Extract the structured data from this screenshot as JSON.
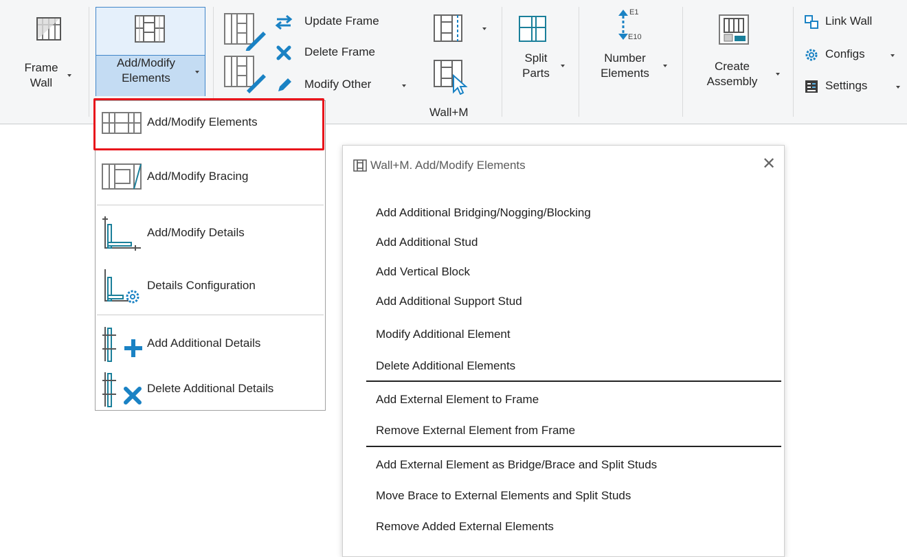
{
  "ribbon": {
    "frame_wall": {
      "line1": "Frame",
      "line2": "Wall"
    },
    "add_modify": {
      "line1": "Add/Modify",
      "line2": "Elements"
    },
    "update_frame": "Update Frame",
    "delete_frame": "Delete Frame",
    "modify_other": "Modify Other",
    "group_title": "Wall+M",
    "split_parts": {
      "line1": "Split",
      "line2": "Parts"
    },
    "number_elements": {
      "line1": "Number",
      "line2": "Elements",
      "tag_top": "E1",
      "tag_bottom": "E10"
    },
    "create_assembly": {
      "line1": "Create",
      "line2": "Assembly"
    },
    "link_wall": "Link Wall",
    "configs": "Configs",
    "settings": "Settings"
  },
  "dropdown": {
    "items": [
      {
        "label": "Add/Modify  Elements"
      },
      {
        "label": "Add/Modify  Bracing"
      },
      {
        "label": "Add/Modify  Details"
      },
      {
        "label": "Details  Configuration"
      },
      {
        "label": "Add Additional  Details"
      },
      {
        "label": "Delete Additional  Details"
      }
    ]
  },
  "dialog": {
    "title": "Wall+M. Add/Modify Elements",
    "items": [
      "Add Additional Bridging/Nogging/Blocking",
      "Add Additional Stud",
      "Add Vertical Block",
      "Add Additional Support Stud",
      "Modify Additional Element",
      "Delete Additional Elements",
      "Add External Element to Frame",
      "Remove External Element from Frame",
      "Add External Element as Bridge/Brace and Split Studs",
      "Move Brace to External Elements and Split Studs",
      "Remove Added External Elements"
    ]
  },
  "colors": {
    "accent": "#1a82c4",
    "highlight_border": "#e8141b",
    "active_button": "#c4dcf3",
    "icon_gray": "#8a8a8a",
    "icon_teal": "#1a7f9a"
  }
}
